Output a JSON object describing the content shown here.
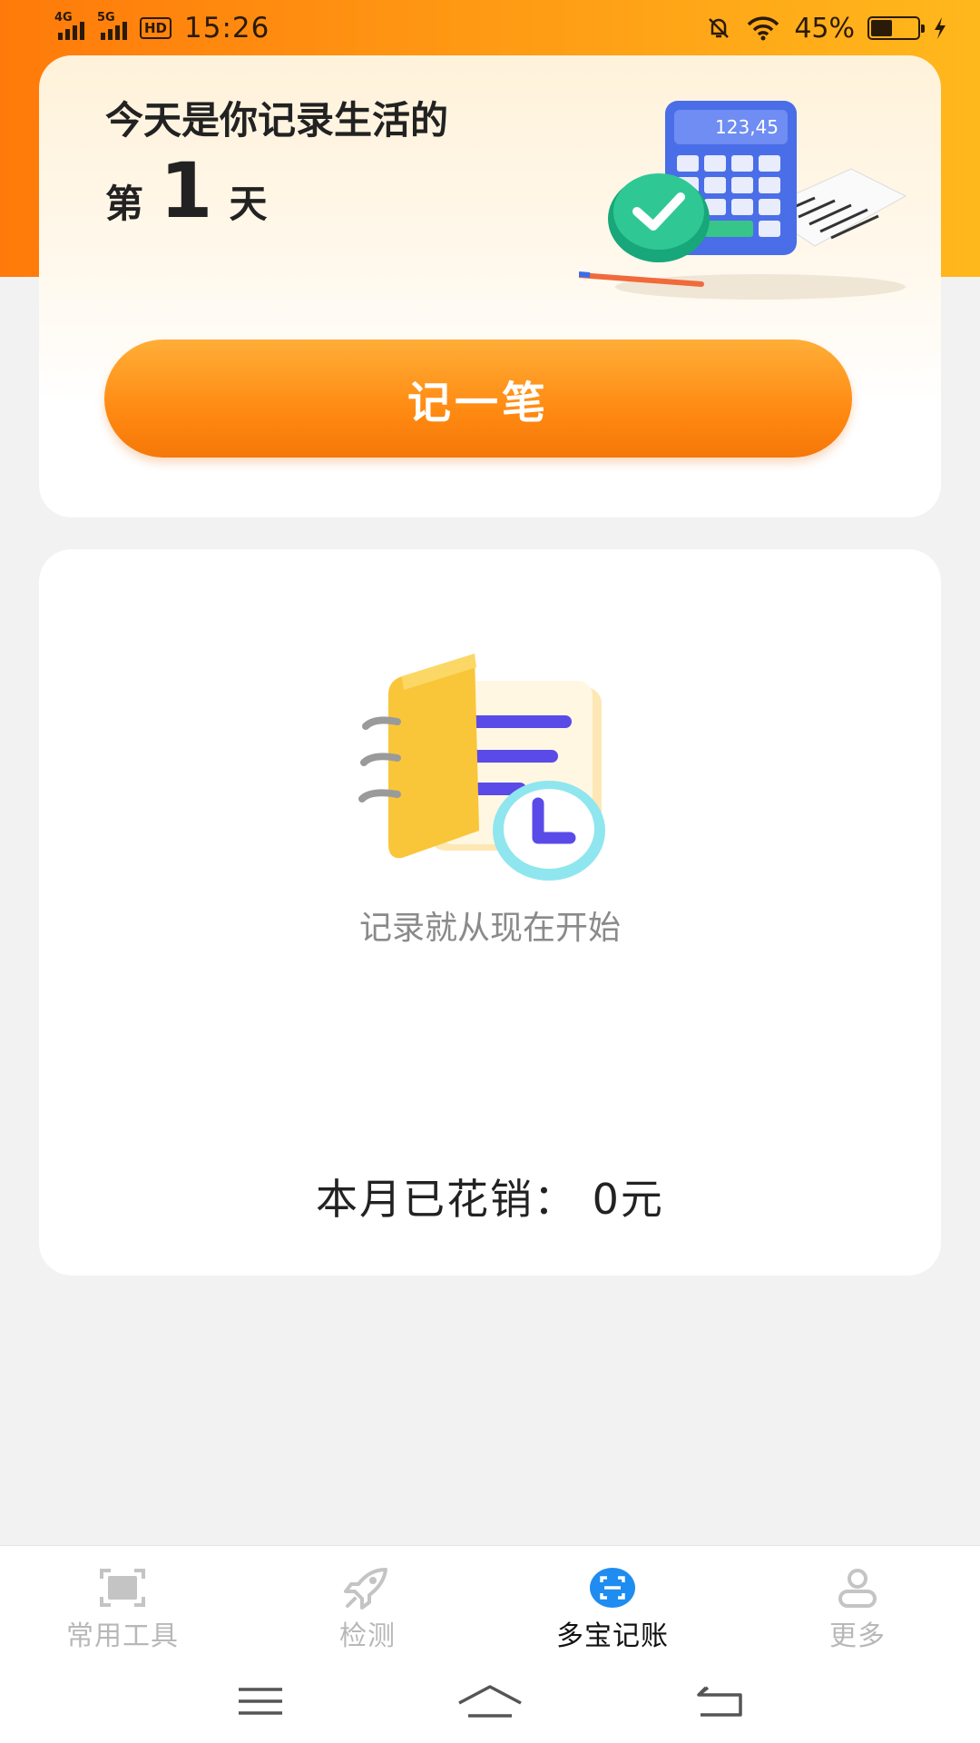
{
  "status_bar": {
    "network_1": "4G",
    "network_2": "5G",
    "hd_badge": "HD",
    "time": "15:26",
    "battery_percent": "45%",
    "battery_level": 0.45
  },
  "header_card": {
    "greeting_line1": "今天是你记录生活的",
    "day_prefix": "第",
    "day_count": "1",
    "day_suffix": "天",
    "calculator_display": "123,45",
    "record_button_label": "记一笔"
  },
  "summary_card": {
    "empty_text": "记录就从现在开始",
    "monthly_spent": "本月已花销：  0元"
  },
  "tabs": [
    {
      "label": "常用工具",
      "icon": "scan-frame-icon",
      "active": false
    },
    {
      "label": "检测",
      "icon": "rocket-icon",
      "active": false
    },
    {
      "label": "多宝记账",
      "icon": "ledger-scan-icon",
      "active": true
    },
    {
      "label": "更多",
      "icon": "person-icon",
      "active": false
    }
  ],
  "colors": {
    "accent_orange": "#ff8a12",
    "tab_active_blue": "#1e8cf0",
    "tab_inactive": "#b8b8b8"
  }
}
